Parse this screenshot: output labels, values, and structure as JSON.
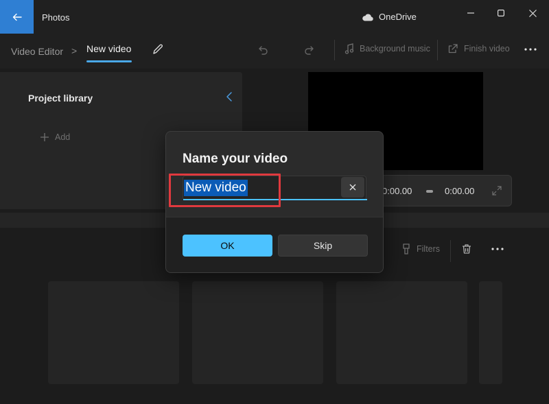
{
  "window": {
    "app_name": "Photos",
    "cloud_label": "OneDrive"
  },
  "breadcrumb": {
    "root": "Video Editor",
    "separator": ">",
    "current": "New video"
  },
  "toolbar": {
    "background_music": "Background music",
    "finish_video": "Finish video"
  },
  "library": {
    "title": "Project library",
    "add_label": "Add"
  },
  "player": {
    "current_time": "0:00.00",
    "total_time": "0:00.00"
  },
  "storyboard": {
    "filters_label": "Filters"
  },
  "dialog": {
    "title": "Name your video",
    "input_value": "New video",
    "ok_label": "OK",
    "skip_label": "Skip"
  },
  "colors": {
    "accent": "#4cc2ff",
    "back_button": "#2f7fd3",
    "highlight": "#e0393e",
    "selection": "#0b5bb6"
  },
  "icons": [
    "back-arrow-icon",
    "cloud-icon",
    "minimize-icon",
    "maximize-icon",
    "close-icon",
    "pencil-icon",
    "undo-icon",
    "redo-icon",
    "music-note-icon",
    "share-icon",
    "more-icon",
    "chevron-left-icon",
    "plus-icon",
    "expand-icon",
    "filters-icon",
    "trash-icon",
    "clear-icon"
  ]
}
